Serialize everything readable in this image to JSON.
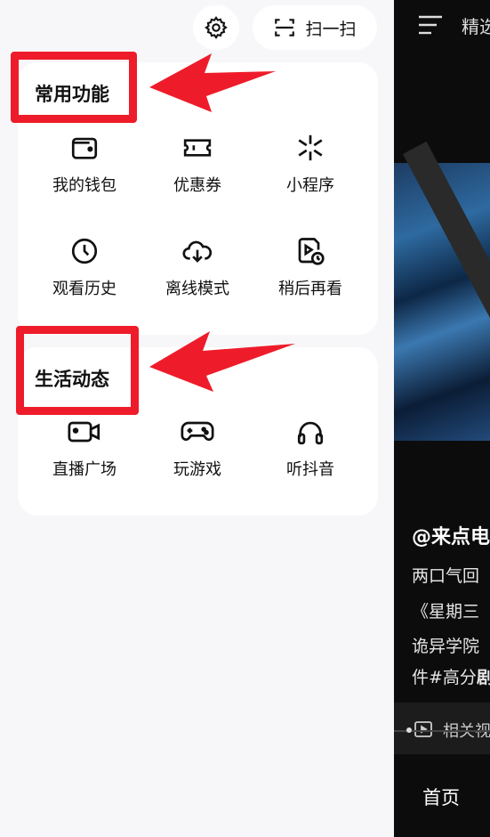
{
  "header": {
    "scan_label": "扫一扫"
  },
  "common_section": {
    "title": "常用功能",
    "items": [
      {
        "label": "我的钱包",
        "icon": "wallet-icon"
      },
      {
        "label": "优惠券",
        "icon": "coupon-icon"
      },
      {
        "label": "小程序",
        "icon": "mini-program-icon"
      },
      {
        "label": "观看历史",
        "icon": "history-clock-icon"
      },
      {
        "label": "离线模式",
        "icon": "cloud-download-icon"
      },
      {
        "label": "稍后再看",
        "icon": "watch-later-icon"
      }
    ]
  },
  "life_section": {
    "title": "生活动态",
    "items": [
      {
        "label": "直播广场",
        "icon": "live-camera-icon"
      },
      {
        "label": "玩游戏",
        "icon": "gamepad-icon"
      },
      {
        "label": "听抖音",
        "icon": "headphones-icon"
      }
    ]
  },
  "feed": {
    "tab_partial": "精选",
    "author": "@来点电",
    "desc_lines": [
      "两口气回",
      "《星期三",
      "诡异学院",
      "件#高分"
    ],
    "desc_suffix": "剧",
    "related_label": "相关视",
    "home_tab": "首页"
  },
  "colors": {
    "annotation_red": "#ee1c2a",
    "card_bg": "#ffffff",
    "drawer_bg": "#f7f7f9"
  }
}
